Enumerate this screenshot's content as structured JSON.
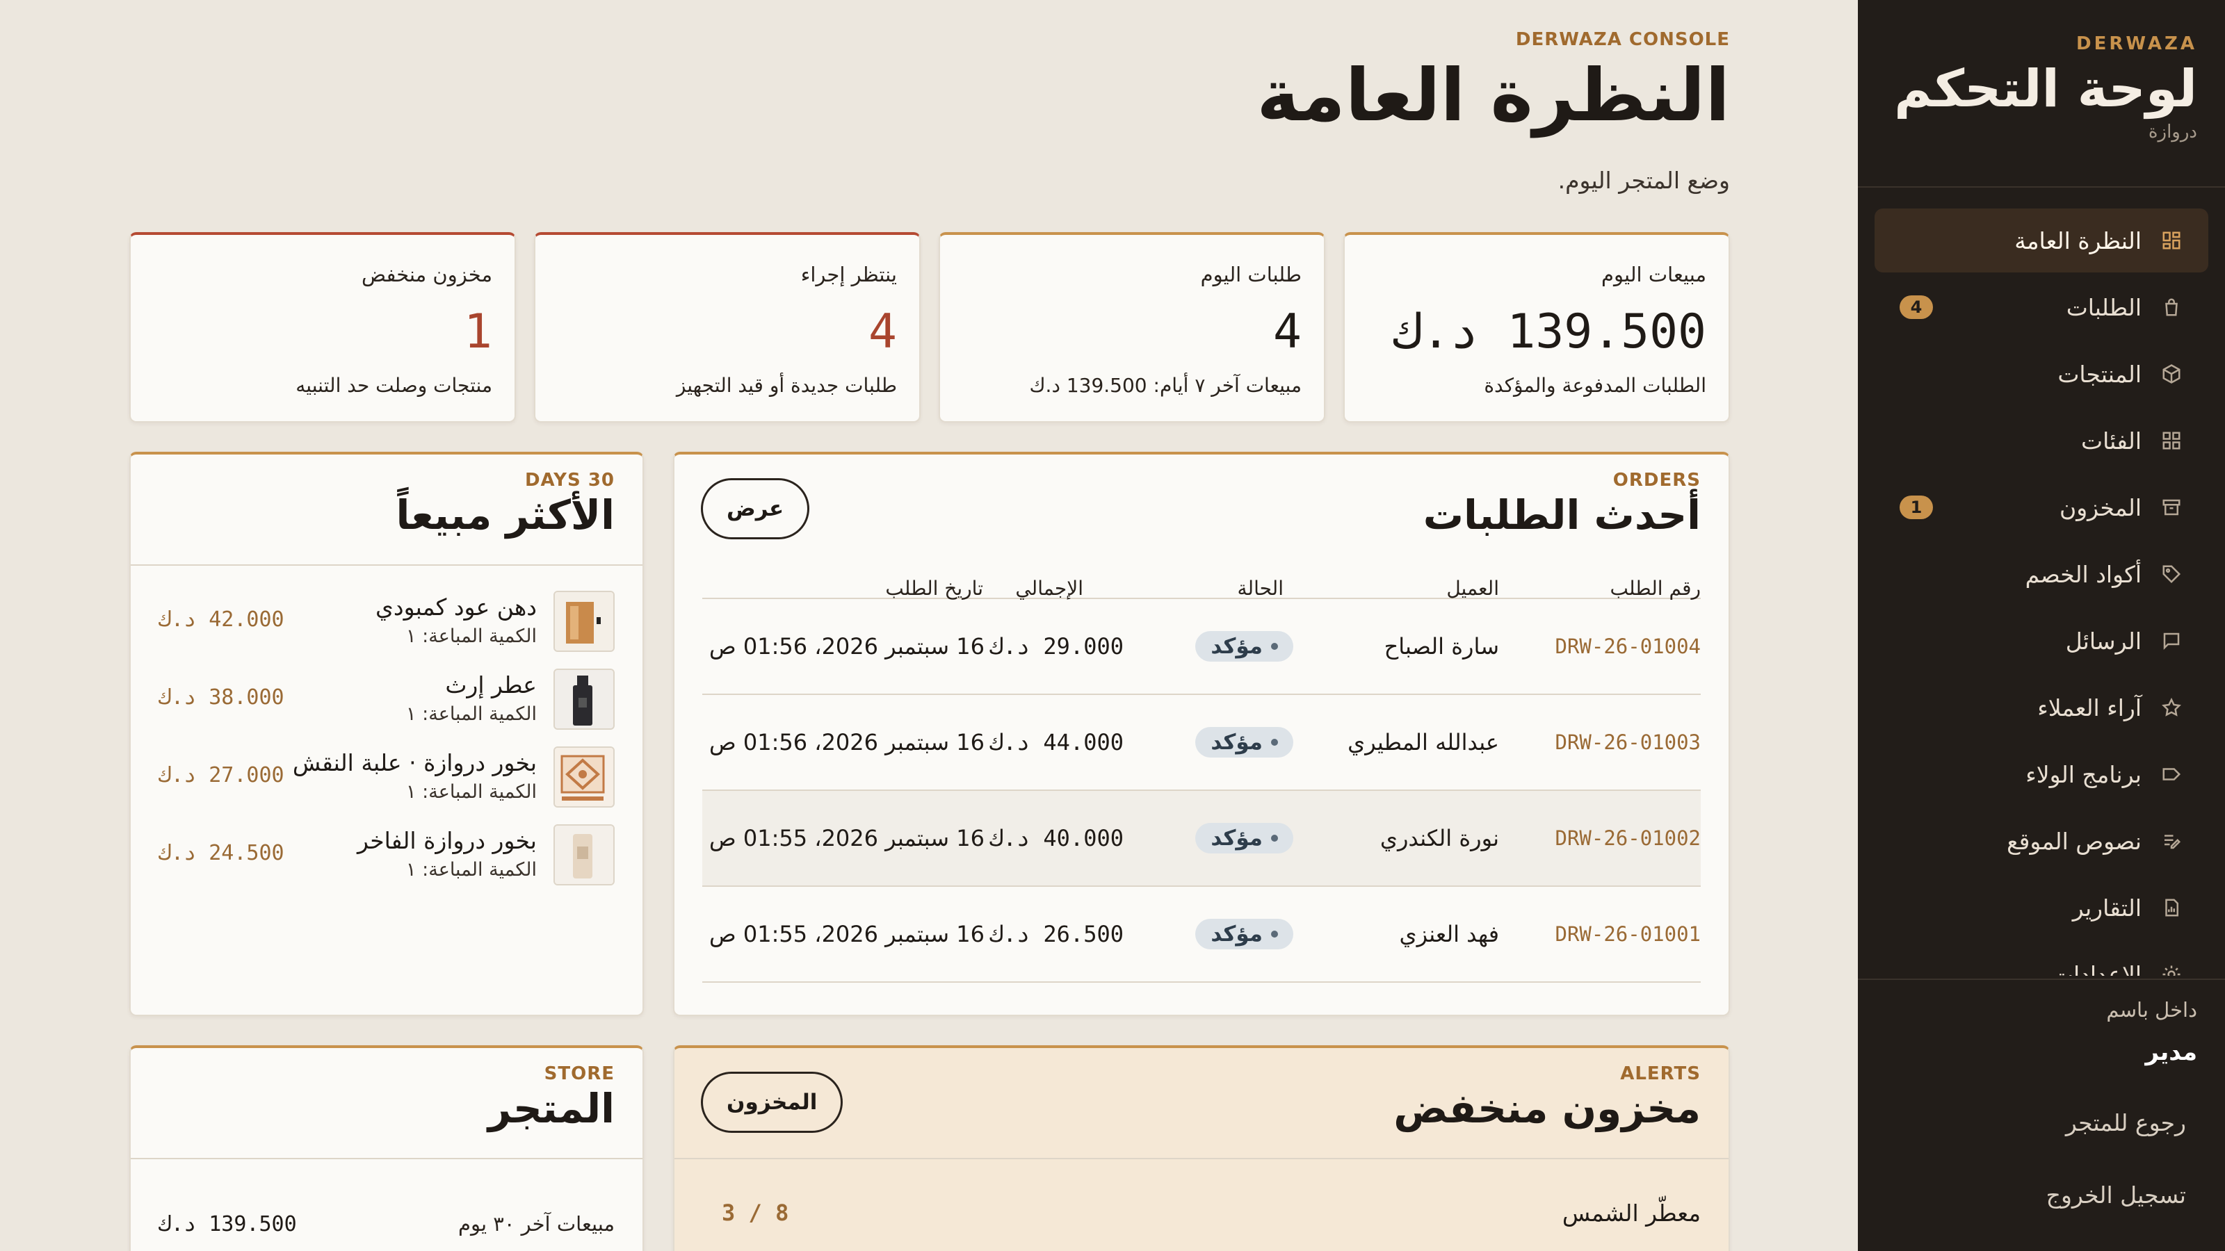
{
  "sidebar": {
    "kicker": "DERWAZA",
    "title": "لوحة التحكم",
    "subtitle": "دروازة",
    "items": [
      {
        "label": "النظرة العامة",
        "icon": "dashboard-icon",
        "active": true,
        "badge": ""
      },
      {
        "label": "الطلبات",
        "icon": "bag-icon",
        "active": false,
        "badge": "4"
      },
      {
        "label": "المنتجات",
        "icon": "box-icon",
        "active": false,
        "badge": ""
      },
      {
        "label": "الفئات",
        "icon": "grid-icon",
        "active": false,
        "badge": ""
      },
      {
        "label": "المخزون",
        "icon": "archive-icon",
        "active": false,
        "badge": "1"
      },
      {
        "label": "أكواد الخصم",
        "icon": "tag-icon",
        "active": false,
        "badge": ""
      },
      {
        "label": "الرسائل",
        "icon": "message-icon",
        "active": false,
        "badge": ""
      },
      {
        "label": "آراء العملاء",
        "icon": "star-icon",
        "active": false,
        "badge": ""
      },
      {
        "label": "برنامج الولاء",
        "icon": "label-icon",
        "active": false,
        "badge": ""
      },
      {
        "label": "نصوص الموقع",
        "icon": "edit-icon",
        "active": false,
        "badge": ""
      },
      {
        "label": "التقارير",
        "icon": "report-icon",
        "active": false,
        "badge": ""
      },
      {
        "label": "الإعدادات",
        "icon": "settings-icon",
        "active": false,
        "badge": ""
      }
    ],
    "signed_in_label": "داخل باسم",
    "role": "مدير",
    "back_to_store": "رجوع للمتجر",
    "logout": "تسجيل الخروج"
  },
  "header": {
    "kicker": "DERWAZA CONSOLE",
    "title": "النظرة العامة",
    "subtitle": "وضع المتجر اليوم."
  },
  "stats": [
    {
      "title": "مبيعات اليوم",
      "value": "139.500 د.ك",
      "note": "الطلبات المدفوعة والمؤكدة",
      "tone": "normal"
    },
    {
      "title": "طلبات اليوم",
      "value": "4",
      "note": "مبيعات آخر ٧ أيام: 139.500 د.ك",
      "tone": "normal"
    },
    {
      "title": "ينتظر إجراء",
      "value": "4",
      "note": "طلبات جديدة أو قيد التجهيز",
      "tone": "danger"
    },
    {
      "title": "مخزون منخفض",
      "value": "1",
      "note": "منتجات وصلت حد التنبيه",
      "tone": "danger"
    }
  ],
  "orders": {
    "kicker": "ORDERS",
    "title": "أحدث الطلبات",
    "view_button": "عرض",
    "columns": {
      "id": "رقم الطلب",
      "customer": "العميل",
      "status": "الحالة",
      "total": "الإجمالي",
      "date": "تاريخ الطلب"
    },
    "rows": [
      {
        "id": "DRW-26-01004",
        "customer": "سارة الصباح",
        "status": "مؤكد",
        "total": "29.000 د.ك",
        "date": "16 سبتمبر 2026، 01:56 ص"
      },
      {
        "id": "DRW-26-01003",
        "customer": "عبدالله المطيري",
        "status": "مؤكد",
        "total": "44.000 د.ك",
        "date": "16 سبتمبر 2026، 01:56 ص"
      },
      {
        "id": "DRW-26-01002",
        "customer": "نورة الكندري",
        "status": "مؤكد",
        "total": "40.000 د.ك",
        "date": "16 سبتمبر 2026، 01:55 ص"
      },
      {
        "id": "DRW-26-01001",
        "customer": "فهد العنزي",
        "status": "مؤكد",
        "total": "26.500 د.ك",
        "date": "16 سبتمبر 2026، 01:55 ص"
      }
    ]
  },
  "bestsellers": {
    "kicker": "30 DAYS",
    "title": "الأكثر مبيعاً",
    "items": [
      {
        "name": "دهن عود كمبودي",
        "qty": "الكمية المباعة: ١",
        "amount": "42.000 د.ك",
        "thumb_color": "#C98A4B"
      },
      {
        "name": "عطر إرث",
        "qty": "الكمية المباعة: ١",
        "amount": "38.000 د.ك",
        "thumb_color": "#2B2A2E"
      },
      {
        "name": "بخور دروازة · علبة النقش",
        "qty": "الكمية المباعة: ١",
        "amount": "27.000 د.ك",
        "thumb_color": "#C27A45"
      },
      {
        "name": "بخور دروازة الفاخر",
        "qty": "الكمية المباعة: ١",
        "amount": "24.500 د.ك",
        "thumb_color": "#E6D6C2"
      }
    ]
  },
  "alerts": {
    "kicker": "ALERTS",
    "title": "مخزون منخفض",
    "button": "المخزون",
    "rows": [
      {
        "name": "معطّر الشمس",
        "qty": "8 / 3"
      }
    ]
  },
  "store": {
    "kicker": "STORE",
    "title": "المتجر",
    "rows": [
      {
        "label": "مبيعات آخر ٣٠ يوم",
        "value": "139.500 د.ك"
      }
    ]
  },
  "colors": {
    "accent": "#C8924C",
    "danger": "#B54A32",
    "sidebar": "#221D19",
    "background": "#ECE7DE"
  }
}
